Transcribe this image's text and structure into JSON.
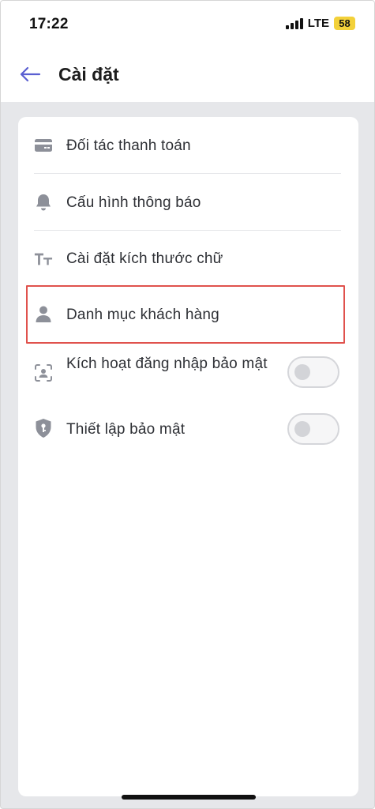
{
  "status_bar": {
    "time": "17:22",
    "network": "LTE",
    "battery": "58",
    "signal_icon": "signal-bars-icon"
  },
  "header": {
    "back_icon": "arrow-left-icon",
    "title": "Cài đặt"
  },
  "settings": {
    "items": [
      {
        "label": "Đối tác thanh toán",
        "icon": "credit-card-icon"
      },
      {
        "label": "Cấu hình thông báo",
        "icon": "bell-icon"
      },
      {
        "label": "Cài đặt kích thước chữ",
        "icon": "text-size-icon"
      },
      {
        "label": "Danh mục khách hàng",
        "icon": "user-icon",
        "highlighted": true
      },
      {
        "label": "Kích hoạt đăng nhập bảo mật",
        "icon": "face-id-icon",
        "toggle": false
      },
      {
        "label": "Thiết lập bảo mật",
        "icon": "shield-key-icon",
        "toggle": false
      }
    ]
  },
  "colors": {
    "accent": "#5a5fd1",
    "highlight_border": "#e0524d",
    "icon_gray": "#8d9099",
    "battery": "#f3d13a",
    "background": "#e6e7ea"
  }
}
